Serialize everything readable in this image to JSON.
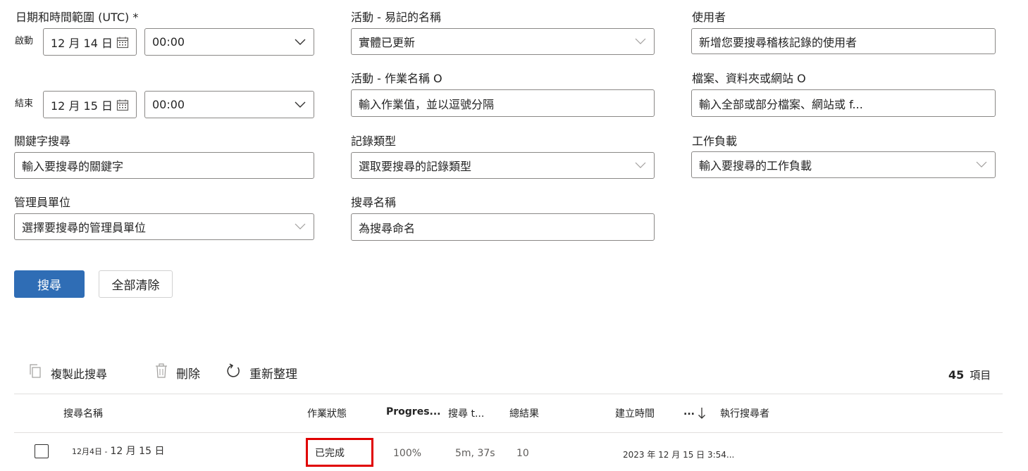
{
  "filters": {
    "date_range": {
      "label": "日期和時間範圍 (UTC) *",
      "start_label": "啟動",
      "start_date": "12 月 14 日",
      "start_time": "00:00",
      "end_label": "結束",
      "end_date": "12 月 15 日",
      "end_time": "00:00"
    },
    "keyword": {
      "label": "關鍵字搜尋",
      "placeholder": "輸入要搜尋的關鍵字"
    },
    "admin_units": {
      "label": "管理員單位",
      "placeholder": "選擇要搜尋的管理員單位"
    },
    "activities_friendly": {
      "label": "活動 - 易記的名稱",
      "value": "實體已更新"
    },
    "activities_operation": {
      "label": "活動 - 作業名稱 O",
      "placeholder": "輸入作業值，並以逗號分隔"
    },
    "record_types": {
      "label": "記錄類型",
      "placeholder": "選取要搜尋的記錄類型"
    },
    "search_name": {
      "label": "搜尋名稱",
      "placeholder": "為搜尋命名"
    },
    "users": {
      "label": "使用者",
      "placeholder": "新增您要搜尋稽核記錄的使用者"
    },
    "files": {
      "label": "檔案、資料夾或網站 O",
      "placeholder": "輸入全部或部分檔案、網站或 f..."
    },
    "workloads": {
      "label": "工作負載",
      "placeholder": "輸入要搜尋的工作負載"
    }
  },
  "actions": {
    "search": "搜尋",
    "clear_all": "全部清除"
  },
  "toolbar": {
    "copy": "複製此搜尋",
    "delete": "刪除",
    "refresh": "重新整理",
    "item_count": "45",
    "item_unit": "項目"
  },
  "table": {
    "columns": {
      "search_name": "搜尋名稱",
      "job_status": "作業狀態",
      "progress": "Progres...",
      "search_time": "搜尋 t...",
      "total_results": "總結果",
      "created": "建立時間",
      "more": "...",
      "sort_icon": "arrow-down-icon",
      "run_by": "執行搜尋者"
    },
    "rows": [
      {
        "name_prefix": "12月4日 -",
        "name_suffix": "12 月 15 日",
        "status": "已完成",
        "progress": "100%",
        "search_time": "5m, 37s",
        "total_results": "10",
        "created": "2023 年 12 月 15 日 3:54..."
      }
    ]
  },
  "colors": {
    "primary": "#2f6db5",
    "highlight": "#e00000",
    "border": "#8a8886"
  }
}
